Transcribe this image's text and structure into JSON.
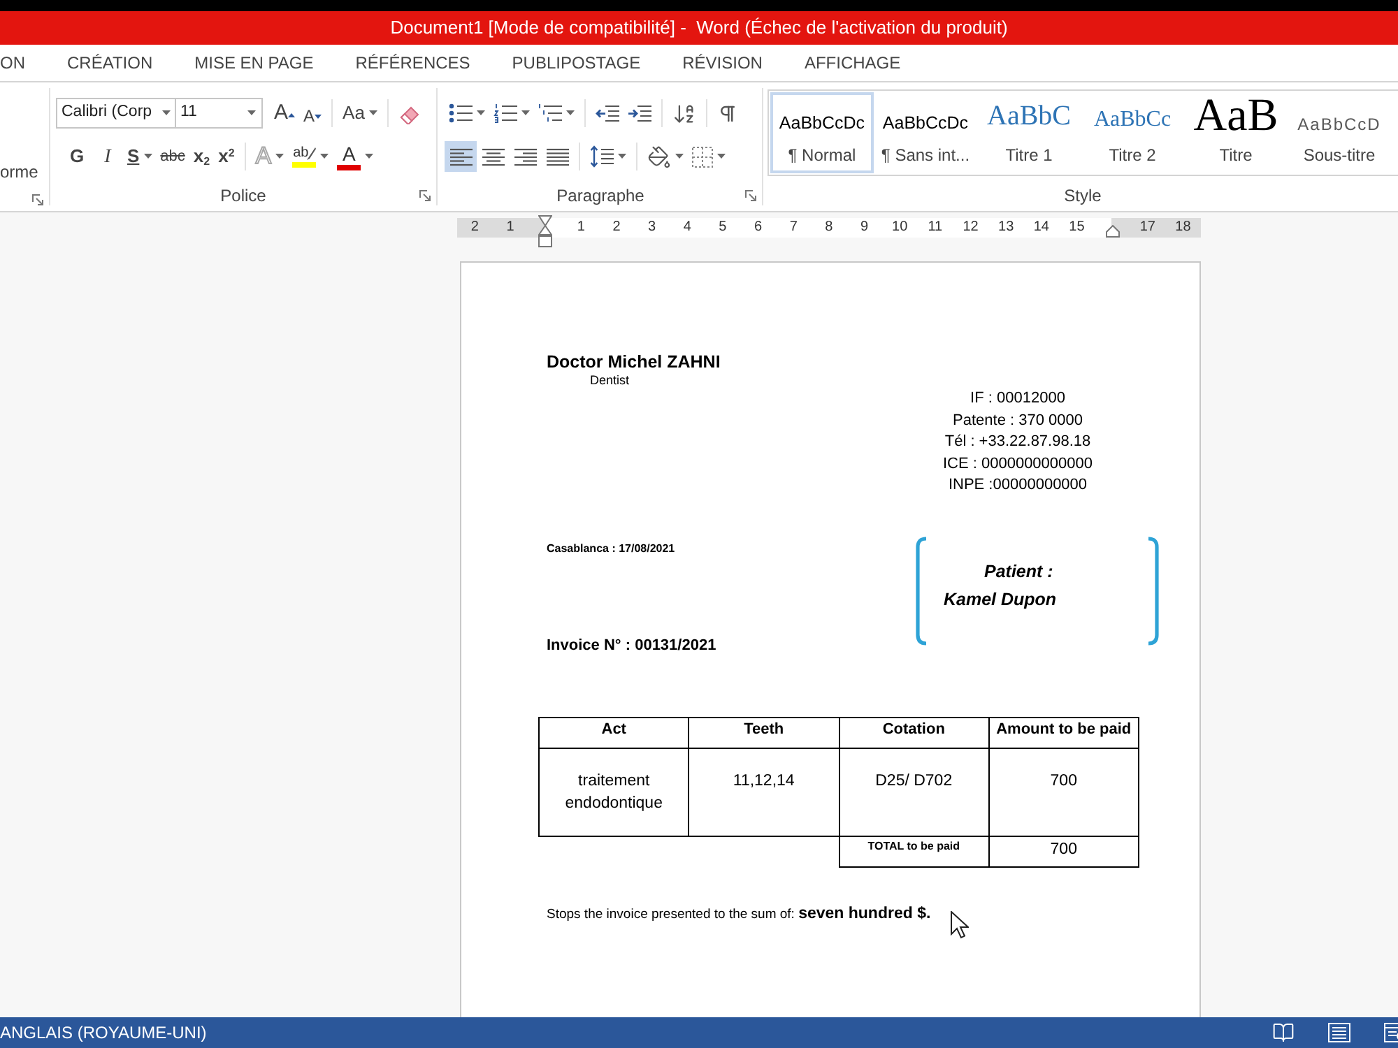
{
  "window": {
    "title": "Document1 [Mode de compatibilité] -  Word (Échec de l'activation du produit)"
  },
  "tabs": [
    {
      "label": "ON",
      "selected": false
    },
    {
      "label": "CRÉATION",
      "selected": false
    },
    {
      "label": "MISE EN PAGE",
      "selected": false
    },
    {
      "label": "RÉFÉRENCES",
      "selected": false
    },
    {
      "label": "PUBLIPOSTAGE",
      "selected": false
    },
    {
      "label": "RÉVISION",
      "selected": false
    },
    {
      "label": "AFFICHAGE",
      "selected": false
    }
  ],
  "ribbon": {
    "fragment": {
      "label": "orme"
    },
    "font_group": {
      "label": "Police",
      "font_name": "Calibri (Corp",
      "font_size": "11",
      "row_1": [
        {
          "kind": "grow",
          "label": "A"
        },
        {
          "kind": "shrink",
          "label": "A"
        },
        {
          "kind": "case",
          "label": "Aa"
        },
        {
          "kind": "clear"
        }
      ],
      "row_2": [
        {
          "kind": "bold",
          "label": "G"
        },
        {
          "kind": "italic",
          "label": "I"
        },
        {
          "kind": "underline",
          "label": "S"
        },
        {
          "kind": "strike",
          "label": "abc"
        },
        {
          "kind": "subscript",
          "label": "x$_{2}$"
        },
        {
          "kind": "superscript",
          "label": "x$^{2}$"
        },
        {
          "kind": "effects",
          "label": "A"
        },
        {
          "kind": "highlight",
          "label": "ab",
          "color": "#ffff00"
        },
        {
          "kind": "font_color",
          "label": "A",
          "color": "#e00000"
        }
      ]
    },
    "paragraph_group": {
      "label": "Paragraphe",
      "row_1": [
        {
          "kind": "bullets"
        },
        {
          "kind": "numbering"
        },
        {
          "kind": "multilevel"
        },
        {
          "kind": "outdent"
        },
        {
          "kind": "indent"
        },
        {
          "kind": "sort"
        },
        {
          "kind": "pilcrow"
        }
      ],
      "row_2": [
        {
          "kind": "align_left",
          "selected": true
        },
        {
          "kind": "align_center",
          "selected": false
        },
        {
          "kind": "align_right",
          "selected": false
        },
        {
          "kind": "justify",
          "selected": false
        },
        {
          "kind": "line_spacing"
        },
        {
          "kind": "shading"
        },
        {
          "kind": "borders"
        }
      ]
    },
    "style_group": {
      "label": "Style",
      "styles": [
        {
          "kind": "normal",
          "preview": "AaBbCcDc",
          "label": "¶ Normal",
          "selected": true
        },
        {
          "kind": "no_spacing",
          "preview": "AaBbCcDc",
          "label": "¶ Sans int...",
          "selected": false
        },
        {
          "kind": "heading_1",
          "preview": "AaBbC",
          "label": "Titre 1",
          "selected": false
        },
        {
          "kind": "heading_2",
          "preview": "AaBbCc",
          "label": "Titre 2",
          "selected": false
        },
        {
          "kind": "title",
          "preview": "AaB",
          "label": "Titre",
          "selected": false
        },
        {
          "kind": "subtitle",
          "preview": "AaBbCcD",
          "label": "Sous-titre",
          "selected": false
        }
      ]
    }
  },
  "ruler": {
    "left_numbers": [
      "2",
      "1"
    ],
    "numbers": [
      "1",
      "2",
      "3",
      "4",
      "5",
      "6",
      "7",
      "8",
      "9",
      "10",
      "11",
      "12",
      "13",
      "14",
      "15"
    ],
    "right_numbers": [
      "17",
      "18"
    ]
  },
  "document": {
    "doctor_name": "Doctor Michel ZAHNI",
    "specialty": "Dentist",
    "identifiers": [
      "IF : 00012000",
      "Patente : 370 0000",
      "Tél : +33.22.87.98.18",
      "ICE : 0000000000000",
      "INPE :00000000000"
    ],
    "place_date": "Casablanca : 17/08/2021",
    "patient": {
      "label": "Patient :",
      "name": "Kamel Dupon"
    },
    "invoice_number": "Invoice N° : 00131/2021",
    "table": {
      "columns": [
        "Act",
        "Teeth",
        "Cotation",
        "Amount to be paid"
      ],
      "rows": [
        [
          "traitement endodontique",
          "11,12,14",
          "D25/ D702",
          "700"
        ]
      ],
      "total": {
        "label": "TOTAL to be paid",
        "value": "700"
      }
    },
    "closing": "Stops the invoice presented to the sum of: **seven hundred $.**"
  },
  "status_bar": {
    "language": "ANGLAIS (ROYAUME-UNI)"
  }
}
